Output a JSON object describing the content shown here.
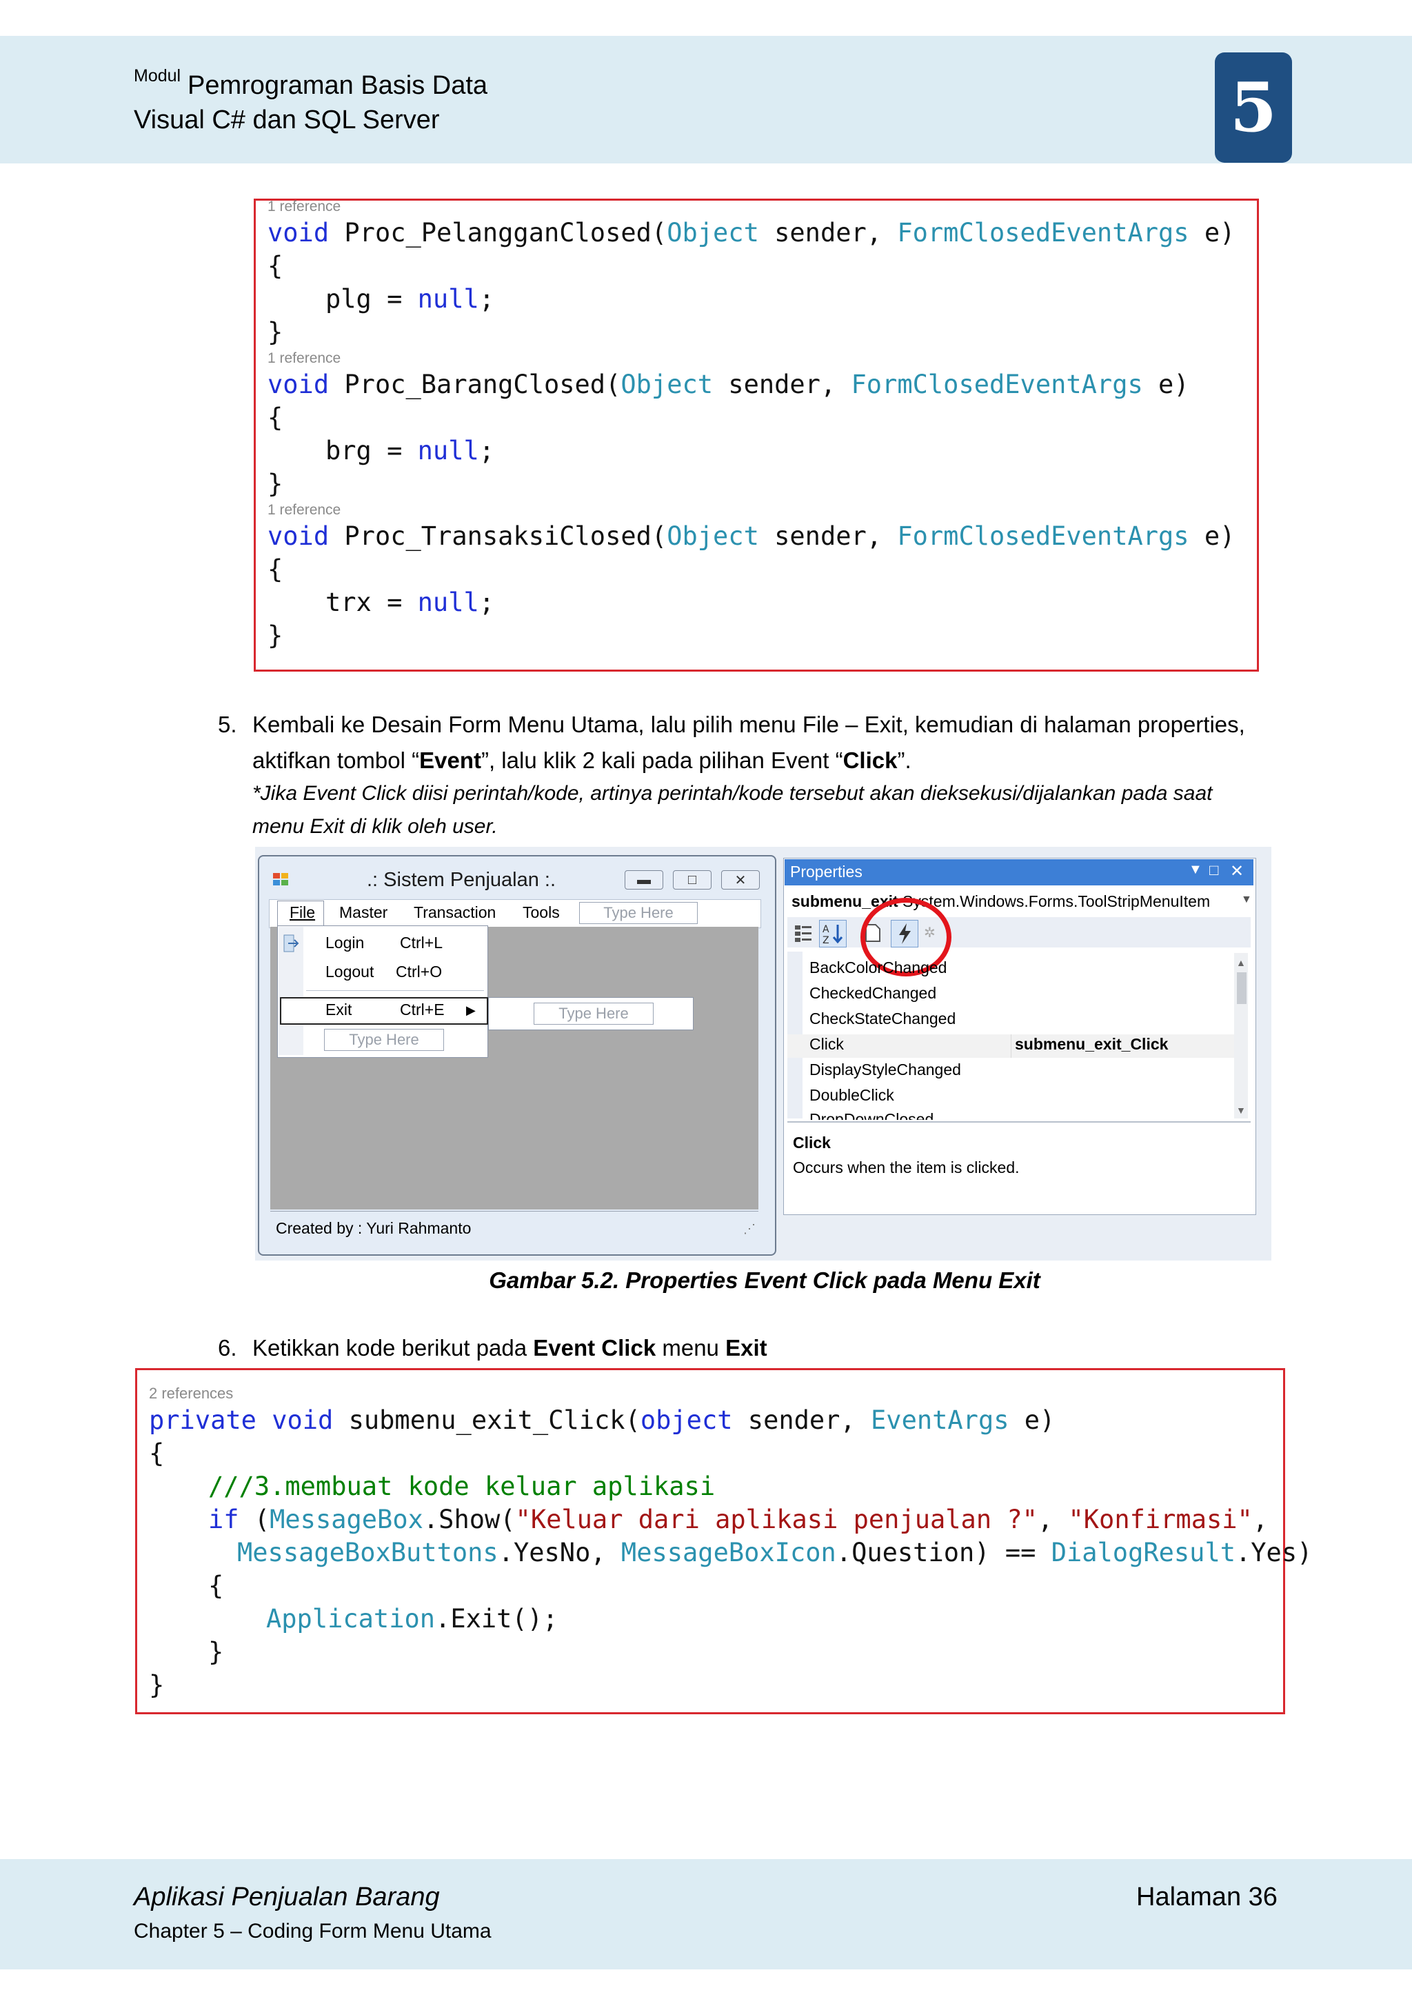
{
  "header": {
    "modul_label": "Modul",
    "title_line1": "Pemrograman Basis Data",
    "title_line2": "Visual C# dan SQL Server",
    "chapter_number": "5"
  },
  "code_block_1": {
    "methods": [
      {
        "refs": "1 reference",
        "line": "void Proc_PelangganClosed(Object sender, FormClosedEventArgs e)",
        "name": "Proc_PelangganClosed",
        "body": "plg = null;",
        "var": "plg"
      },
      {
        "refs": "1 reference",
        "line": "void Proc_BarangClosed(Object sender, FormClosedEventArgs e)",
        "name": "Proc_BarangClosed",
        "body": "brg = null;",
        "var": "brg"
      },
      {
        "refs": "1 reference",
        "line": "void Proc_TransaksiClosed(Object sender, FormClosedEventArgs e)",
        "name": "Proc_TransaksiClosed",
        "body": "trx = null;",
        "var": "trx"
      }
    ]
  },
  "step5": {
    "number": "5.",
    "text_line1": "Kembali ke Desain Form Menu Utama, lalu pilih menu File – Exit, kemudian di halaman properties,",
    "text_line2_pre": "aktifkan tombol “",
    "text_line2_bold1": "Event",
    "text_line2_mid": "”, lalu klik 2 kali pada pilihan Event “",
    "text_line2_bold2": "Click",
    "text_line2_post": "”.",
    "note_line1": "*Jika Event Click diisi perintah/kode, artinya perintah/kode tersebut akan dieksekusi/dijalankan pada saat",
    "note_line2": "menu Exit di klik oleh user."
  },
  "screenshot": {
    "window_title": ".: Sistem Penjualan :.",
    "menu": [
      "File",
      "Master",
      "Transaction",
      "Tools"
    ],
    "type_here": "Type Here",
    "dropdown": [
      {
        "label": "Login",
        "shortcut": "Ctrl+L"
      },
      {
        "label": "Logout",
        "shortcut": "Ctrl+O"
      },
      {
        "label": "Exit",
        "shortcut": "Ctrl+E"
      }
    ],
    "status": "Created by : Yuri Rahmanto",
    "properties": {
      "title": "Properties",
      "object_name": "submenu_exit",
      "object_type": "System.Windows.Forms.ToolStripMenuItem",
      "events": [
        "BackColorChanged",
        "CheckedChanged",
        "CheckStateChanged",
        "Click",
        "DisplayStyleChanged",
        "DoubleClick",
        "DropDownClosed"
      ],
      "click_value": "submenu_exit_Click",
      "desc_title": "Click",
      "desc_text": "Occurs when the item is clicked."
    }
  },
  "caption": "Gambar 5.2. Properties Event Click pada Menu Exit",
  "step6": {
    "number": "6.",
    "pre": "Ketikkan kode berikut pada ",
    "bold1": "Event Click",
    "mid": " menu ",
    "bold2": "Exit"
  },
  "code_block_2": {
    "refs": "2 references",
    "kw_private": "private",
    "kw_void": "void",
    "method": "submenu_exit_Click(",
    "kw_object": "object",
    "sender": "sender,",
    "type_eventargs": "EventArgs",
    "e": "e)",
    "comment": "///3.membuat kode keluar aplikasi",
    "kw_if": "if",
    "type_messagebox": "MessageBox",
    "show": ".Show(",
    "str1": "\"Keluar dari aplikasi penjualan ?\"",
    "comma": ",",
    "str2": "\"Konfirmasi\"",
    "type_buttons": "MessageBoxButtons",
    "yesno": ".YesNo,",
    "type_icon": "MessageBoxIcon",
    "question": ".Question)",
    "eq": "==",
    "type_result": "DialogResult",
    "yes": ".Yes)",
    "type_application": "Application",
    "exit": ".Exit();"
  },
  "footer": {
    "title": "Aplikasi Penjualan Barang",
    "subtitle": "Chapter 5 – Coding Form Menu Utama",
    "page": "Halaman 36"
  }
}
